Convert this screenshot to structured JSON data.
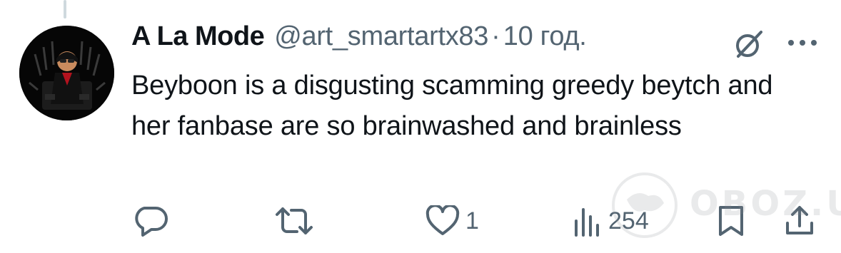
{
  "tweet": {
    "author": {
      "display_name": "A La Mode",
      "handle": "@art_smartartx83"
    },
    "separator": "·",
    "time": "10 год.",
    "text": "Beyboon is a disgusting scamming greedy beytch and her fanbase are so brainwashed and brainless"
  },
  "actions": {
    "reply": {
      "icon": "reply-icon"
    },
    "retweet": {
      "icon": "retweet-icon"
    },
    "like": {
      "icon": "heart-icon",
      "count": "1"
    },
    "views": {
      "icon": "views-icon",
      "count": "254"
    },
    "bookmark": {
      "icon": "bookmark-icon"
    },
    "share": {
      "icon": "share-icon"
    }
  },
  "top_icons": {
    "grok": "grok-icon",
    "more": "more-icon"
  },
  "watermark": {
    "text": "OBOZ.UA"
  },
  "colors": {
    "text_primary": "#0f1419",
    "text_secondary": "#536471",
    "thread_line": "#cfd9de",
    "background": "#ffffff"
  }
}
